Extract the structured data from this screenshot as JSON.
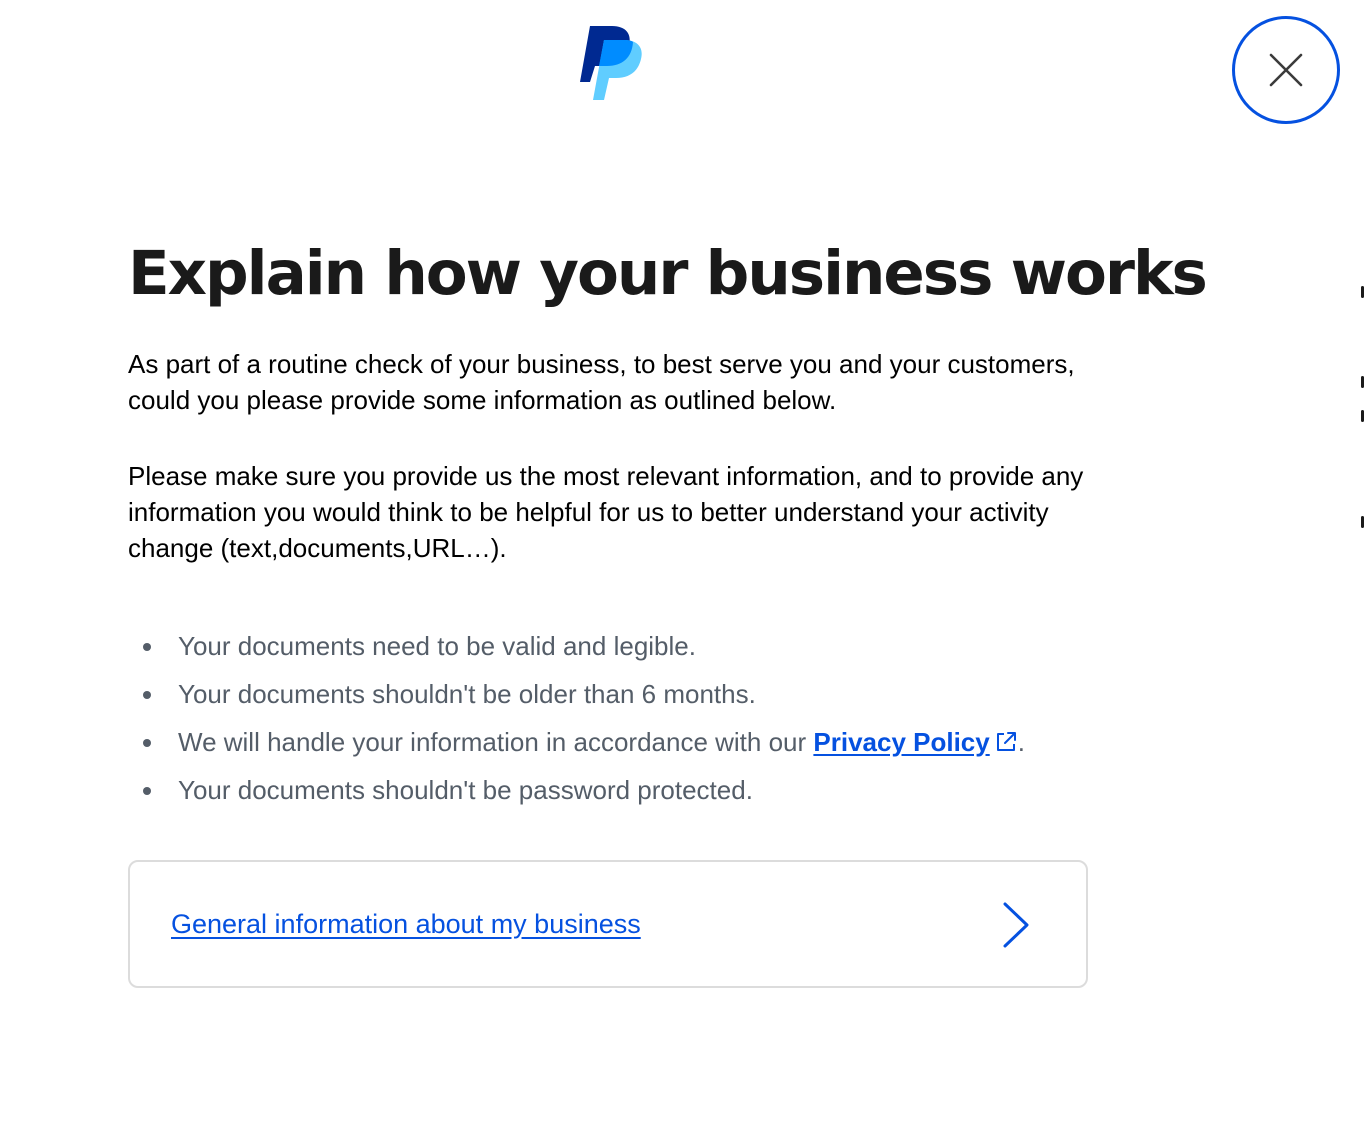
{
  "header": {
    "logo_icon": "paypal-logo",
    "close_icon": "close-icon",
    "close_ring_color": "#0551e0"
  },
  "main": {
    "title": "Explain how your business works",
    "intro": "As part of a routine check of your business, to best serve you and your customers, could you please provide some information as outlined below.",
    "details": "Please make sure you provide us the most relevant information, and to provide any information you would think to be helpful for us to better understand your activity change (text,documents,URL…).",
    "requirements": {
      "item1": "Your documents need to be valid and legible.",
      "item2": "Your documents shouldn't be older than 6 months.",
      "item3_prefix": "We will handle your information in accordance with our ",
      "item3_link": "Privacy Policy",
      "item3_suffix": ".",
      "item4": "Your documents shouldn't be password protected."
    },
    "external_link_icon": "external-link-icon"
  },
  "card": {
    "link_label": "General information about my business",
    "chevron_icon": "chevron-right-icon"
  },
  "colors": {
    "accent": "#0551e0",
    "heading": "#1a1a1a",
    "body": "#000000",
    "secondary": "#545d68",
    "card_border": "#dcdcdc"
  }
}
